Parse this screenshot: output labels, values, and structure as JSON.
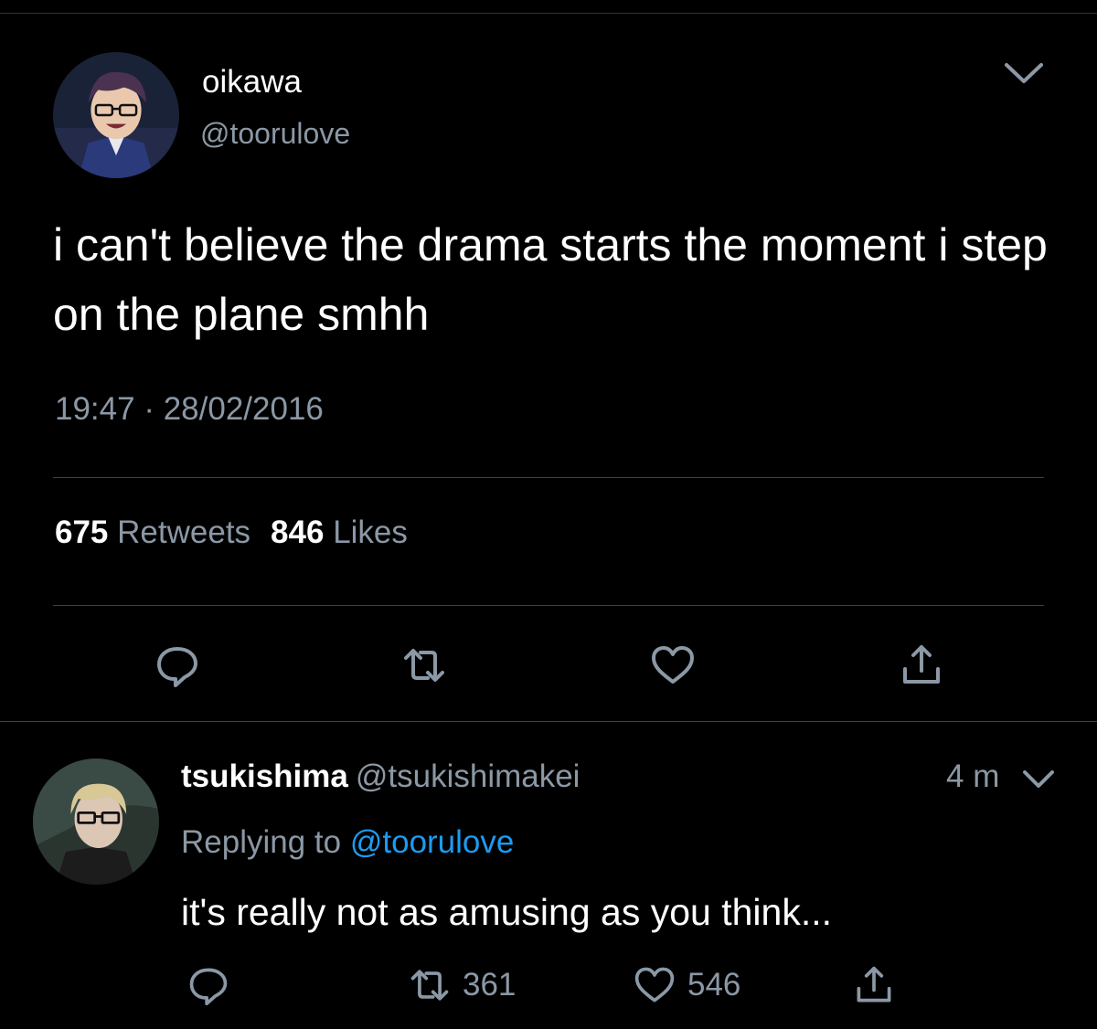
{
  "tweet": {
    "author_name": "oikawa",
    "author_handle": "@toorulove",
    "avatar_icon": "anime-character-avatar",
    "text": "i can't believe the drama starts the moment i step on the plane smhh",
    "time": "19:47",
    "separator": "·",
    "date": "28/02/2016",
    "retweet_count": "675",
    "retweet_label": "Retweets",
    "like_count": "846",
    "like_label": "Likes",
    "icons": [
      "chevron-down-icon",
      "reply-icon",
      "retweet-icon",
      "heart-icon",
      "share-icon"
    ]
  },
  "reply": {
    "author_name": "tsukishima",
    "author_handle": "@tsukishimakei",
    "avatar_icon": "anime-character-avatar",
    "time": "4 m",
    "replying_prefix": "Replying to",
    "replying_to": "@toorulove",
    "text": "it's really not as amusing as you think...",
    "retweet_count": "361",
    "like_count": "546",
    "icons": [
      "chevron-down-icon",
      "reply-icon",
      "retweet-icon",
      "heart-icon",
      "share-icon"
    ]
  },
  "colors": {
    "background": "#000000",
    "text": "#ffffff",
    "secondary_text": "#8b98a5",
    "mention": "#1d9bf0",
    "divider": "#3c4146"
  }
}
